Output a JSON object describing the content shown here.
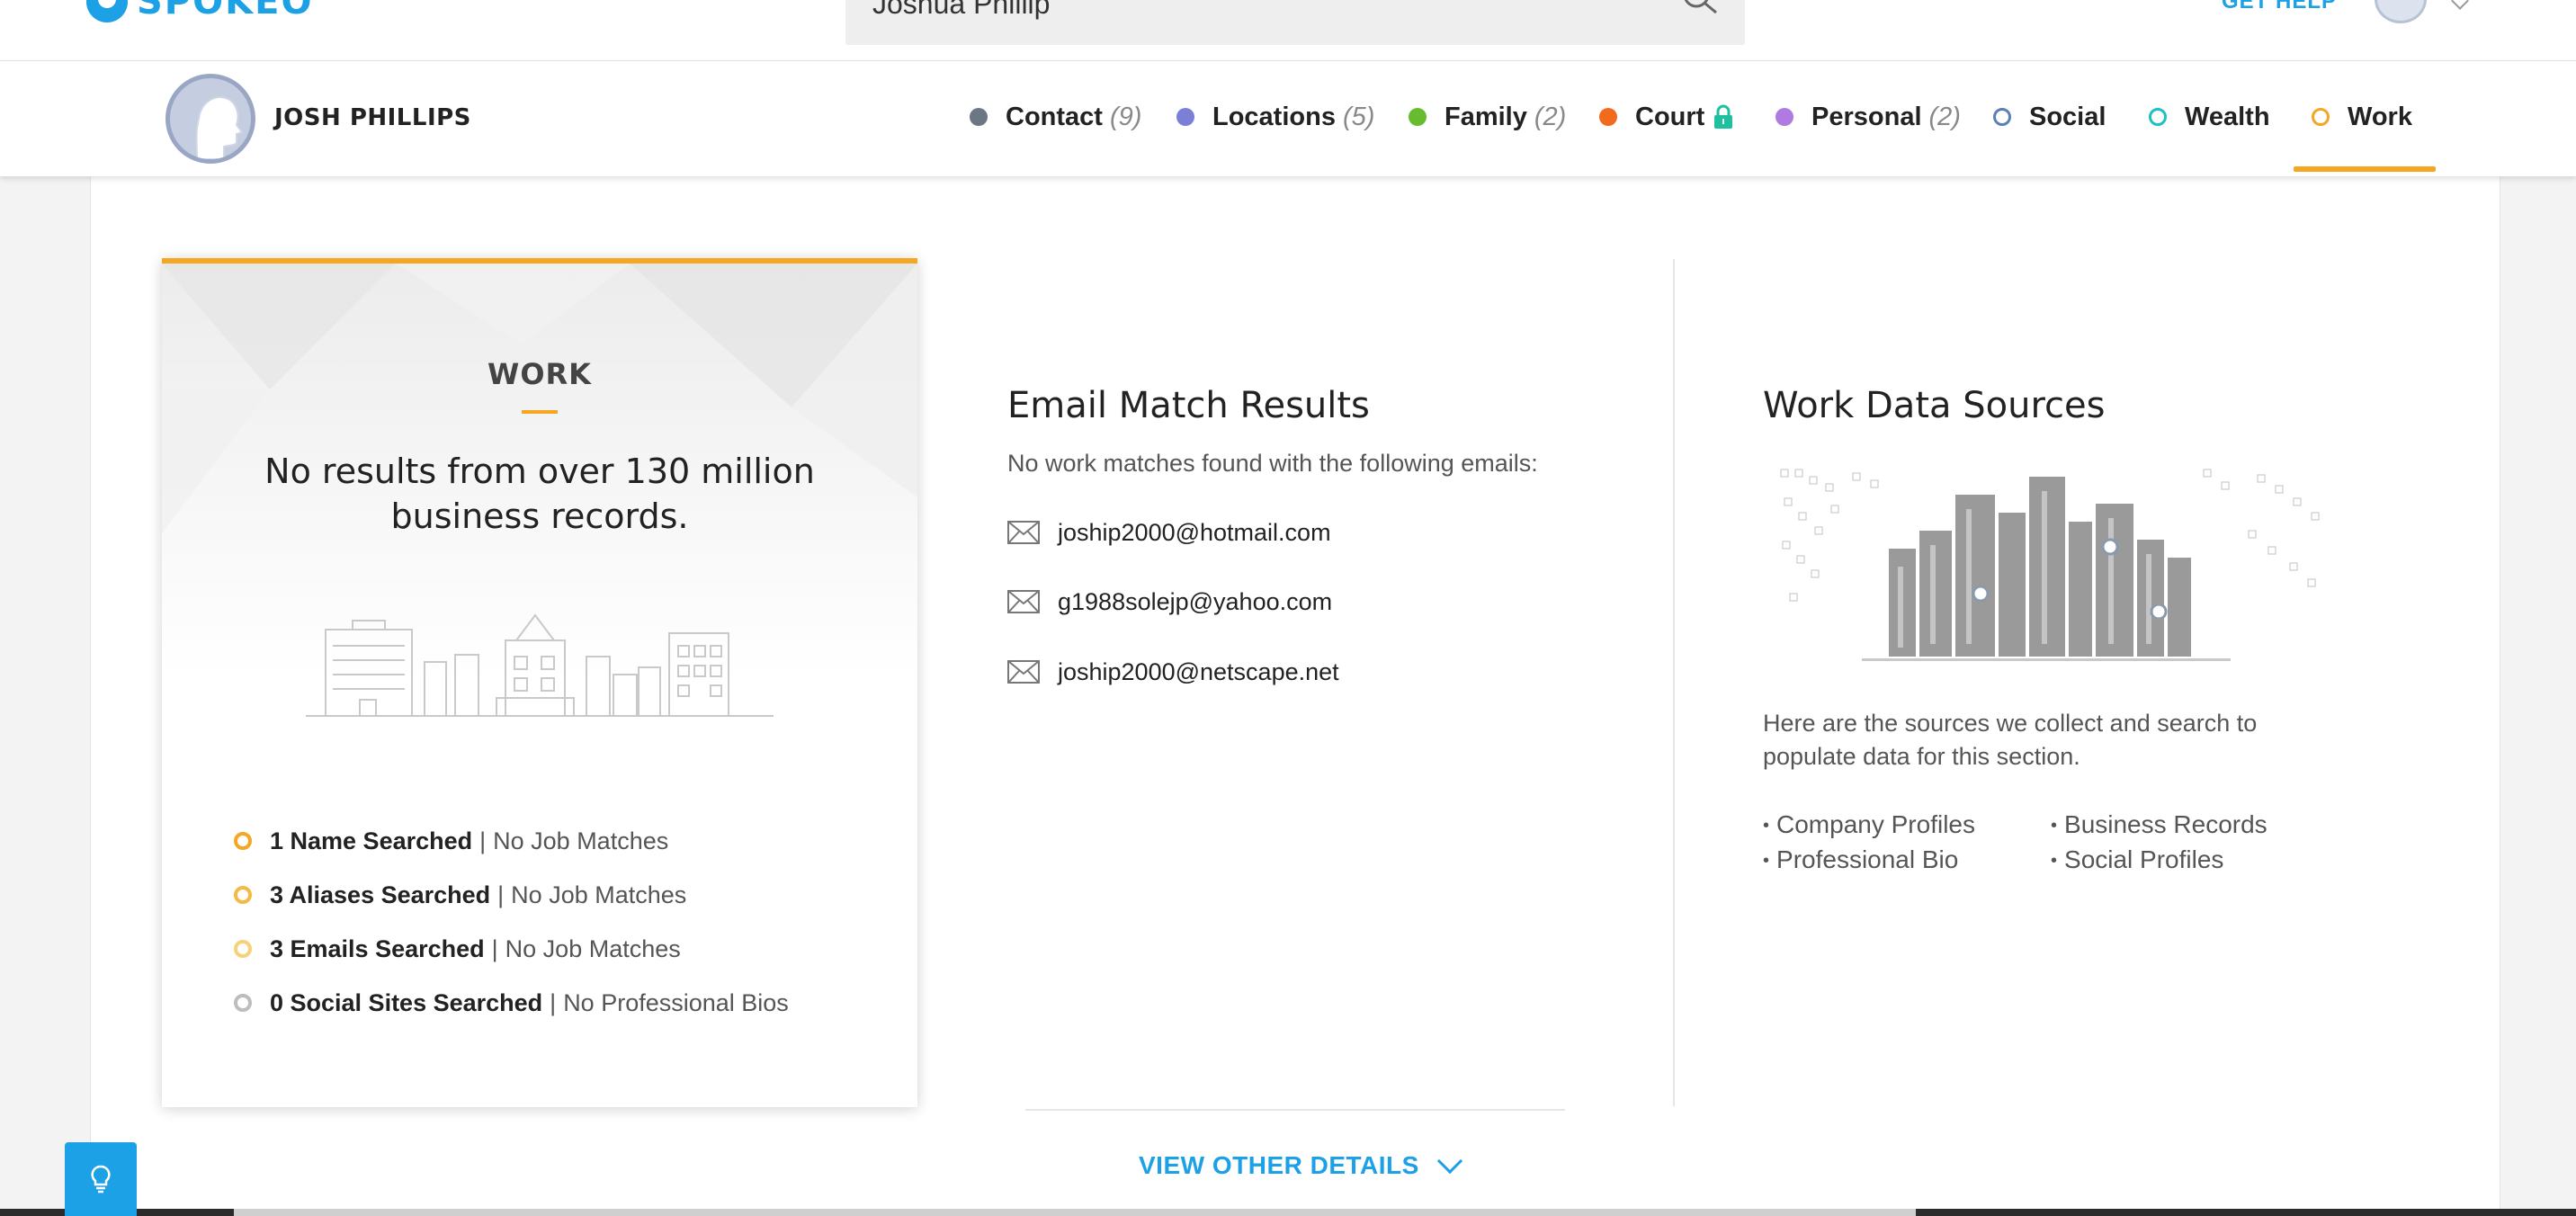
{
  "header": {
    "logo_text": "SPOKEO",
    "search_value": "Joshua Phillip",
    "get_help": "GET HELP"
  },
  "profile": {
    "name": "JOSH PHILLIPS"
  },
  "tabs": [
    {
      "label": "Contact",
      "count": "(9)",
      "color": "#6b7785",
      "style": "filled"
    },
    {
      "label": "Locations",
      "count": "(5)",
      "color": "#7b7fd6",
      "style": "filled"
    },
    {
      "label": "Family",
      "count": "(2)",
      "color": "#66bb2e",
      "style": "filled"
    },
    {
      "label": "Court",
      "count": "",
      "color": "#f26a1b",
      "style": "filled",
      "locked": true
    },
    {
      "label": "Personal",
      "count": "(2)",
      "color": "#b07ae0",
      "style": "filled"
    },
    {
      "label": "Social",
      "count": "",
      "color": "#5b7fb5",
      "style": "hollow"
    },
    {
      "label": "Wealth",
      "count": "",
      "color": "#1fc0c0",
      "style": "hollow"
    },
    {
      "label": "Work",
      "count": "",
      "color": "#f5a623",
      "style": "hollow",
      "active": true
    }
  ],
  "work_card": {
    "title": "WORK",
    "lead": "No results from over 130 million business records.",
    "stats": [
      {
        "strong": "1 Name Searched",
        "rest": "No Job Matches",
        "color": "#f5a623"
      },
      {
        "strong": "3 Aliases Searched",
        "rest": "No Job Matches",
        "color": "#f5b944"
      },
      {
        "strong": "3 Emails Searched",
        "rest": "No Job Matches",
        "color": "#f8d27a"
      },
      {
        "strong": "0 Social Sites Searched",
        "rest": "No Professional Bios",
        "color": "#bdbdbd"
      }
    ],
    "separator": "|"
  },
  "email_match": {
    "title": "Email Match Results",
    "subtitle": "No work matches found with the following emails:",
    "emails": [
      "joship2000@hotmail.com",
      "g1988solejp@yahoo.com",
      "joship2000@netscape.net"
    ]
  },
  "sources": {
    "title": "Work Data Sources",
    "description": "Here are the sources we collect and search to populate data for this section.",
    "col1": [
      "Company Profiles",
      "Professional Bio"
    ],
    "col2": [
      "Business Records",
      "Social Profiles"
    ]
  },
  "view_other_details": "VIEW OTHER DETAILS",
  "colors": {
    "accent": "#f5a623",
    "link": "#1da1e6"
  }
}
